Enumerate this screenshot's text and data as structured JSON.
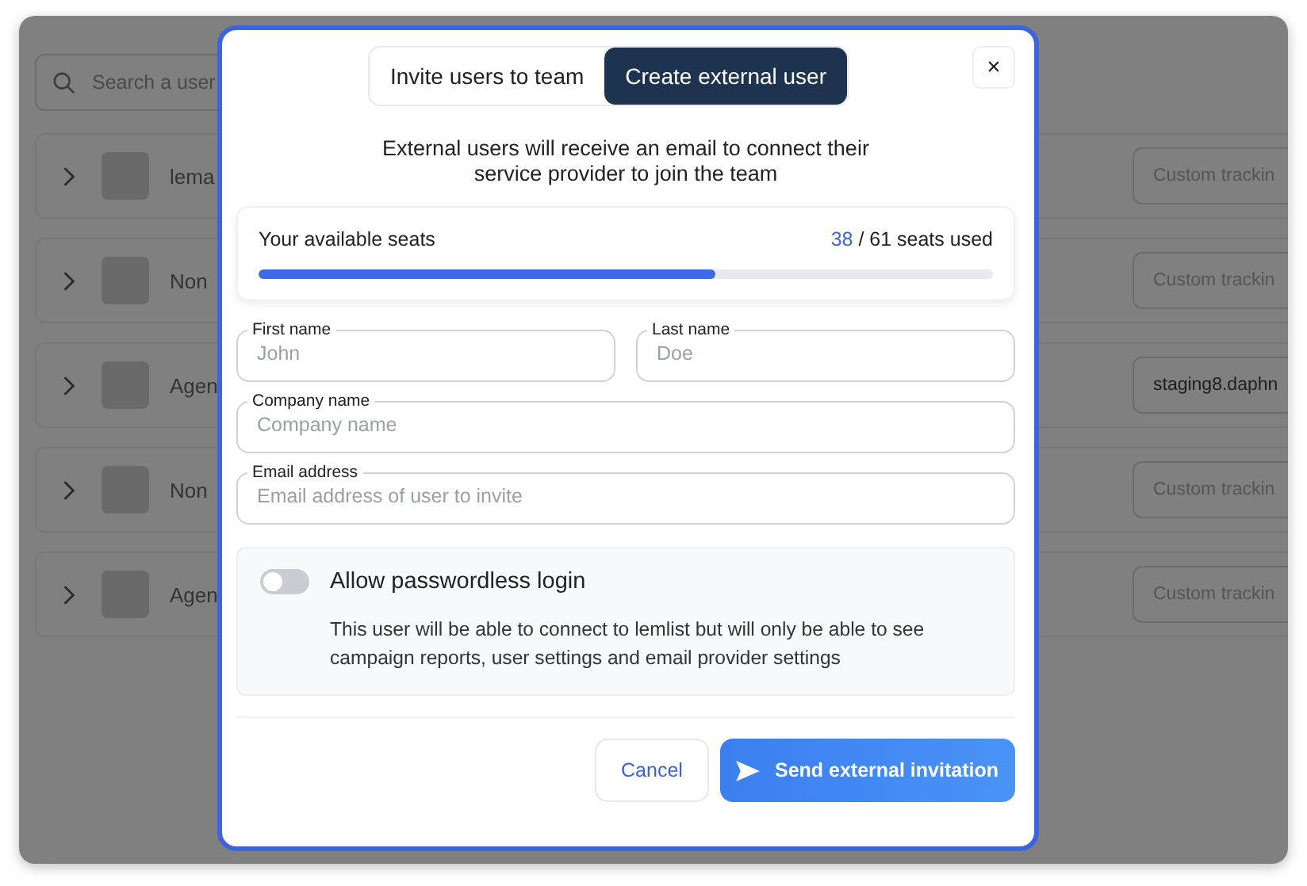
{
  "background": {
    "search": {
      "placeholder": "Search a user"
    },
    "rows": [
      {
        "name": "lema",
        "tracking": {
          "placeholder": "Custom trackin"
        }
      },
      {
        "name": "Non",
        "tracking": {
          "placeholder": "Custom trackin"
        }
      },
      {
        "name": "Agen",
        "tracking": {
          "value": "staging8.daphn"
        }
      },
      {
        "name": "Non",
        "tracking": {
          "placeholder": "Custom trackin"
        }
      },
      {
        "name": "Agen",
        "tracking": {
          "placeholder": "Custom trackin"
        }
      }
    ]
  },
  "modal": {
    "tabs": [
      {
        "label": "Invite users to team",
        "selected": false
      },
      {
        "label": "Create external user",
        "selected": true
      }
    ],
    "close": "×",
    "description": "External users will receive an email to connect their service provider to join the team",
    "seats": {
      "label": "Your available seats",
      "used": "38",
      "total": "/ 61 seats used",
      "level": 0.623
    },
    "field_rows": [
      [
        {
          "label": "First name",
          "placeholder": "John"
        },
        {
          "label": "Last name",
          "placeholder": "Doe"
        }
      ],
      [
        {
          "label": "Company name",
          "placeholder": "Company name"
        }
      ],
      [
        {
          "label": "Email address",
          "placeholder": "Email address of user to invite"
        }
      ]
    ],
    "passwordless": {
      "on": false,
      "title": "Allow passwordless login",
      "description": "This user will be able to connect to lemlist but will only be able to see campaign reports, user settings and email provider settings"
    },
    "buttons": {
      "cancel": "Cancel",
      "send": "Send external invitation"
    }
  }
}
